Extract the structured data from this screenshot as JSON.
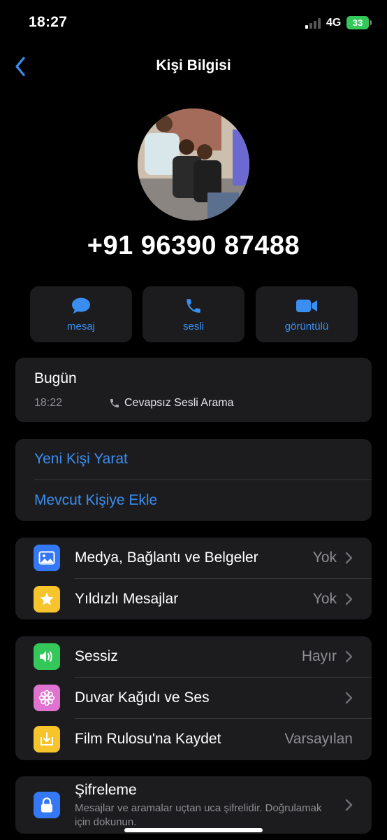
{
  "status_bar": {
    "time": "18:27",
    "network": "4G",
    "battery": "33"
  },
  "nav": {
    "title": "Kişi Bilgisi"
  },
  "contact": {
    "phone": "+91 96390 87488"
  },
  "actions": [
    {
      "label": "mesaj",
      "icon": "message-bubble-icon"
    },
    {
      "label": "sesli",
      "icon": "phone-icon"
    },
    {
      "label": "görüntülü",
      "icon": "video-camera-icon"
    }
  ],
  "history": {
    "title": "Bugün",
    "time": "18:22",
    "description": "Cevapsız Sesli Arama"
  },
  "contact_links": {
    "create": "Yeni Kişi Yarat",
    "add_existing": "Mevcut Kişiye Ekle"
  },
  "media_section": [
    {
      "label": "Medya, Bağlantı ve Belgeler",
      "value": "Yok",
      "icon": "photo-icon",
      "color": "#3478f6"
    },
    {
      "label": "Yıldızlı Mesajlar",
      "value": "Yok",
      "icon": "star-icon",
      "color": "#f7c52b"
    }
  ],
  "settings_section": [
    {
      "label": "Sessiz",
      "value": "Hayır",
      "icon": "speaker-icon",
      "color": "#34c759"
    },
    {
      "label": "Duvar Kağıdı ve Ses",
      "value": "",
      "icon": "flower-icon",
      "color": "#e072d0"
    },
    {
      "label": "Film Rulosu'na Kaydet",
      "value": "Varsayılan",
      "icon": "download-icon",
      "color": "#f7c52b"
    }
  ],
  "encryption": {
    "title": "Şifreleme",
    "subtitle": "Mesajlar ve aramalar uçtan uca şifrelidir. Doğrulamak için dokunun.",
    "icon": "lock-icon",
    "color": "#3478f6"
  }
}
